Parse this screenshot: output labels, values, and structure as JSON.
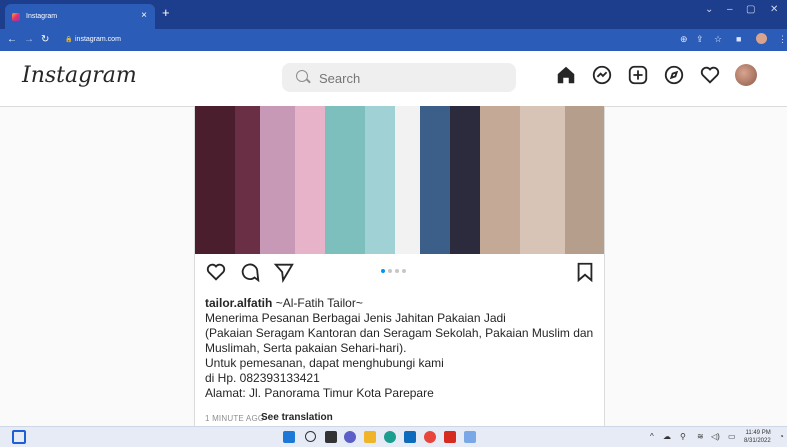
{
  "browser": {
    "tab_title": "Instagram",
    "new_tab": "+",
    "url": "instagram.com",
    "window_minimize": "–",
    "window_maximize": "▢",
    "window_close": "✕"
  },
  "instagram": {
    "logo": "Instagram",
    "search_placeholder": "Search"
  },
  "post": {
    "username": "tailor.alfatih",
    "caption_lines": [
      "~Al-Fatih Tailor~",
      "Menerima Pesanan Berbagai Jenis Jahitan Pakaian Jadi",
      "(Pakaian Seragam Kantoran dan Seragam Sekolah, Pakaian Muslim dan",
      "Muslimah, Serta pakaian Sehari-hari).",
      "Untuk pemesanan, dapat menghubungi kami",
      "di Hp. 082393133421",
      "Alamat: Jl. Panorama Timur Kota Parepare"
    ],
    "time": "1 MINUTE AGO",
    "see_translation": "See translation",
    "carousel_dots": 4,
    "carousel_active": 1
  },
  "taskbar": {
    "time": "11:49 PM",
    "date": "8/31/2022"
  },
  "colors": {
    "chrome_dark": "#1d3e8c",
    "chrome_bar": "#2b5cb8",
    "ig_blue": "#0095f6"
  }
}
